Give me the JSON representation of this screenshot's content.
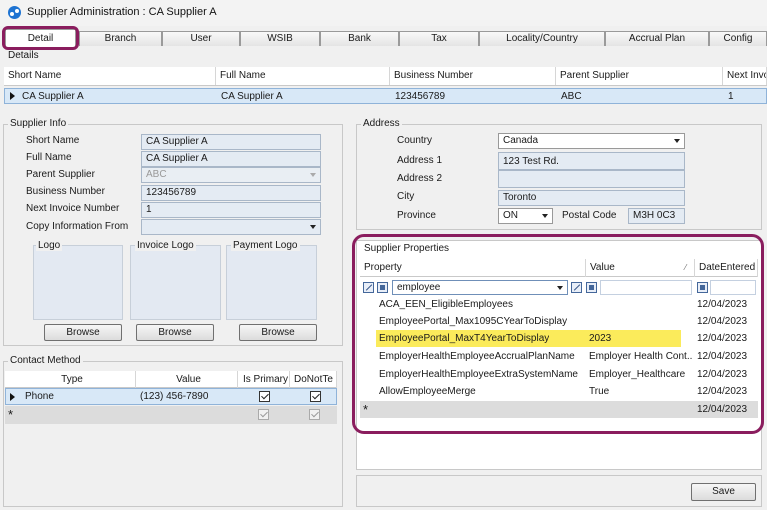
{
  "window": {
    "title": "Supplier Administration : CA Supplier A"
  },
  "tabs": [
    {
      "label": "Detail",
      "active": true
    },
    {
      "label": "Branch"
    },
    {
      "label": "User"
    },
    {
      "label": "WSIB"
    },
    {
      "label": "Bank"
    },
    {
      "label": "Tax"
    },
    {
      "label": "Locality/Country"
    },
    {
      "label": "Accrual Plan"
    },
    {
      "label": "Config"
    }
  ],
  "details": {
    "title": "Details",
    "columns": [
      "Short Name",
      "Full Name",
      "Business Number",
      "Parent Supplier",
      "Next Invo"
    ],
    "row": [
      "CA Supplier A",
      "CA Supplier A",
      "123456789",
      "ABC",
      "1"
    ]
  },
  "supplier_info": {
    "title": "Supplier Info",
    "short_name_label": "Short Name",
    "short_name": "CA Supplier A",
    "full_name_label": "Full Name",
    "full_name": "CA Supplier A",
    "parent_label": "Parent Supplier",
    "parent": "ABC",
    "business_label": "Business Number",
    "business": "123456789",
    "next_invoice_label": "Next Invoice Number",
    "next_invoice": "1",
    "copy_label": "Copy Information From",
    "copy": "",
    "logo_label": "Logo",
    "invoice_logo_label": "Invoice Logo",
    "payment_logo_label": "Payment Logo",
    "browse_label": "Browse"
  },
  "contact": {
    "title": "Contact Method",
    "columns": [
      "Type",
      "Value",
      "Is Primary",
      "DoNotTe"
    ],
    "rows": [
      {
        "type": "Phone",
        "value": "(123) 456-7890"
      }
    ]
  },
  "address": {
    "title": "Address",
    "country_label": "Country",
    "country": "Canada",
    "address1_label": "Address 1",
    "address1": "123 Test Rd.",
    "address2_label": "Address 2",
    "address2": "",
    "city_label": "City",
    "city": "Toronto",
    "province_label": "Province",
    "province": "ON",
    "postal_label": "Postal Code",
    "postal": "M3H 0C3"
  },
  "properties": {
    "title": "Supplier Properties",
    "columns": [
      "Property",
      "Value",
      "DateEntered"
    ],
    "filter": "employee",
    "rows": [
      {
        "property": "ACA_EEN_EligibleEmployees",
        "value": "",
        "date": "12/04/2023"
      },
      {
        "property": "EmployeePortal_Max1095CYearToDisplay",
        "value": "",
        "date": "12/04/2023"
      },
      {
        "property": "EmployeePortal_MaxT4YearToDisplay",
        "value": "2023",
        "date": "12/04/2023",
        "highlight": true
      },
      {
        "property": "EmployerHealthEmployeeAccrualPlanName",
        "value": "Employer Health Cont...",
        "date": "12/04/2023"
      },
      {
        "property": "EmployerHealthEmployeeExtraSystemName",
        "value": "Employer_Healthcare",
        "date": "12/04/2023"
      },
      {
        "property": "AllowEmployeeMerge",
        "value": "True",
        "date": "12/04/2023"
      }
    ],
    "new_row_date": "12/04/2023",
    "highlight_color": "#fbeb5b"
  },
  "footer": {
    "save_label": "Save"
  },
  "colors": {
    "accent_ring": "#8a1d5e",
    "selected_row": "#d8e8f7"
  }
}
